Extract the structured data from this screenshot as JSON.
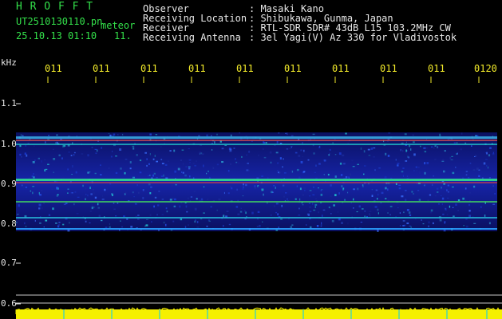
{
  "header": {
    "station": "H R O F F T",
    "filename": "UT2510130110.pn",
    "meteor_label": "meteor",
    "datetime": "25.10.13 01:10",
    "count": "11."
  },
  "info": {
    "labels": [
      "Observer",
      "Receiving Location",
      "Receiver",
      "Receiving Antenna"
    ],
    "values": [
      ": Masaki Kano",
      ": Shibukawa, Gunma, Japan",
      ": RTL-SDR SDR# 43dB L15 103.2MHz CW",
      ": 3el Yagi(V) Az 330 for Vladivostok"
    ]
  },
  "axis": {
    "unit": "kHz",
    "y_ticks": [
      "1.1",
      "1.0",
      "0.9",
      "0.8",
      "0.7",
      "0.6"
    ],
    "x_ticks": [
      "011",
      "011",
      "011",
      "011",
      "011",
      "011",
      "011",
      "011",
      "011",
      "0120"
    ]
  },
  "colors": {
    "text_green": "#33e04a",
    "text_white": "#e8e8e8",
    "tick_yellow": "#f2ea2a",
    "spectrum_blue": "#1020a0",
    "amplitude_yellow": "#f5f000"
  }
}
